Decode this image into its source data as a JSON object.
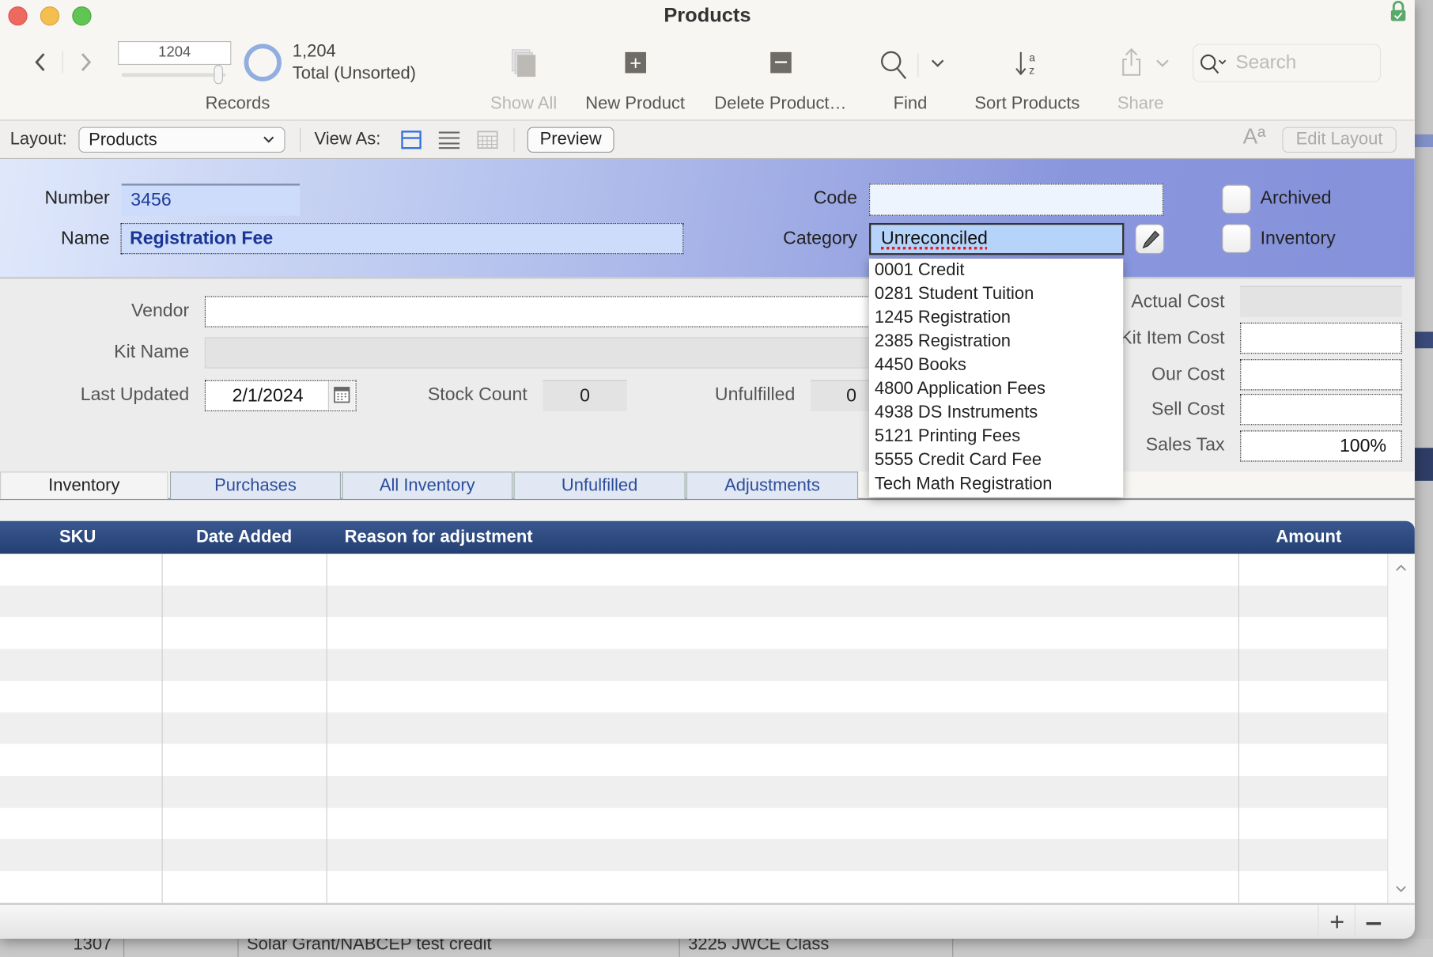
{
  "window": {
    "title": "Products"
  },
  "toolbar": {
    "record_number": "1204",
    "record_count": "1,204",
    "record_status": "Total (Unsorted)",
    "records_label": "Records",
    "show_all": "Show All",
    "new_product": "New Product",
    "delete_product": "Delete Product…",
    "find": "Find",
    "sort_products": "Sort Products",
    "share": "Share",
    "search_placeholder": "Search"
  },
  "layout_bar": {
    "layout_label": "Layout:",
    "layout_value": "Products",
    "view_as_label": "View As:",
    "preview": "Preview",
    "font_icon": "Aª",
    "edit_layout": "Edit Layout"
  },
  "header": {
    "number_label": "Number",
    "number_value": "3456",
    "name_label": "Name",
    "name_value": "Registration Fee",
    "code_label": "Code",
    "code_value": "",
    "category_label": "Category",
    "category_value": "Unreconciled",
    "archived_label": "Archived",
    "inventory_label": "Inventory",
    "archived_checked": false,
    "inventory_checked": false
  },
  "category_options": [
    "0001 Credit",
    "0281 Student Tuition",
    "1245 Registration",
    "2385 Registration",
    "4450 Books",
    "4800 Application Fees",
    "4938 DS Instruments",
    "5121 Printing Fees",
    "5555 Credit Card Fee",
    "Tech Math Registration"
  ],
  "details": {
    "vendor_label": "Vendor",
    "vendor_value": "",
    "kit_name_label": "Kit Name",
    "kit_name_value": "",
    "last_updated_label": "Last Updated",
    "last_updated_value": "2/1/2024",
    "stock_count_label": "Stock Count",
    "stock_count_value": "0",
    "unfulfilled_label": "Unfulfilled",
    "unfulfilled_value": "0",
    "actual_cost_label": "Actual Cost",
    "kit_item_cost_label": "Kit Item Cost",
    "our_cost_label": "Our Cost",
    "sell_cost_label": "Sell Cost",
    "sales_tax_label": "Sales Tax",
    "sales_tax_value": "100%"
  },
  "tabs": [
    {
      "label": "Inventory",
      "active": true
    },
    {
      "label": "Purchases"
    },
    {
      "label": "All Inventory"
    },
    {
      "label": "Unfulfilled"
    },
    {
      "label": "Adjustments"
    }
  ],
  "table": {
    "columns": [
      "SKU",
      "Date Added",
      "Reason for adjustment",
      "Amount"
    ],
    "rows": []
  },
  "background_row": [
    "1307",
    "Solar Grant/NABCEP test credit",
    "3225 JWCE Class"
  ],
  "colors": {
    "header_band_left": "#dfe8fb",
    "header_band_right": "#8a96dc",
    "table_header": "#2e4a7f",
    "accent": "#2a4d9b"
  }
}
